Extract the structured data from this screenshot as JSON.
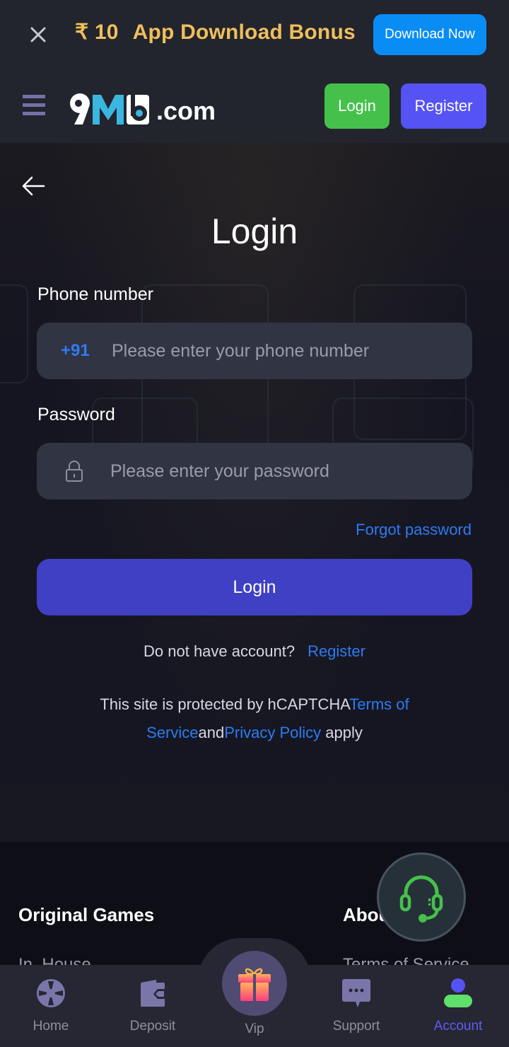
{
  "banner": {
    "currency_symbol": "₹",
    "amount": "10",
    "bonus_text": "App Download Bonus",
    "download_button": "Download Now",
    "icons": {
      "close": "close-icon"
    }
  },
  "header": {
    "logo_mark": "9M6",
    "logo_suffix": ".com",
    "login_button": "Login",
    "register_button": "Register",
    "icons": {
      "menu": "hamburger-icon"
    }
  },
  "login": {
    "title": "Login",
    "phone_label": "Phone number",
    "country_code": "+91",
    "phone_placeholder": "Please enter your phone number",
    "phone_value": "",
    "password_label": "Password",
    "password_placeholder": "Please enter your password",
    "password_value": "",
    "forgot_password": "Forgot password",
    "submit_button": "Login",
    "no_account_text": "Do not have account?",
    "register_link": "Register",
    "captcha_prefix": "This site is protected by hCAPTCHA",
    "terms_link": "Terms of Service",
    "captcha_and": "and",
    "privacy_link": "Privacy Policy",
    "captcha_suffix": " apply",
    "icons": {
      "back": "back-arrow-icon",
      "lock": "lock-icon"
    }
  },
  "footer": {
    "columns": [
      {
        "title": "Original Games",
        "first_item": "In_House"
      },
      {
        "title": "About",
        "first_item": "Terms of Service"
      }
    ]
  },
  "floating_support": {
    "icon": "headset-icon"
  },
  "bottom_nav": {
    "active": "Account",
    "items": [
      {
        "label": "Home",
        "icon": "roulette-wheel-icon"
      },
      {
        "label": "Deposit",
        "icon": "wallet-icon"
      },
      {
        "label": "Vip",
        "icon": "gift-icon"
      },
      {
        "label": "Support",
        "icon": "chat-bubble-icon"
      },
      {
        "label": "Account",
        "icon": "user-icon"
      }
    ]
  },
  "colors": {
    "banner_bg": "#22242e",
    "bonus_text": "#efbf5a",
    "download_button": "#0a8cf5",
    "header_login": "#45c14b",
    "header_register": "#5553f3",
    "primary_button": "#3f40c4",
    "link": "#2d7bf2",
    "field_bg": "#313443",
    "nav_active": "#5f5cf5",
    "support_green": "#45c14b"
  }
}
